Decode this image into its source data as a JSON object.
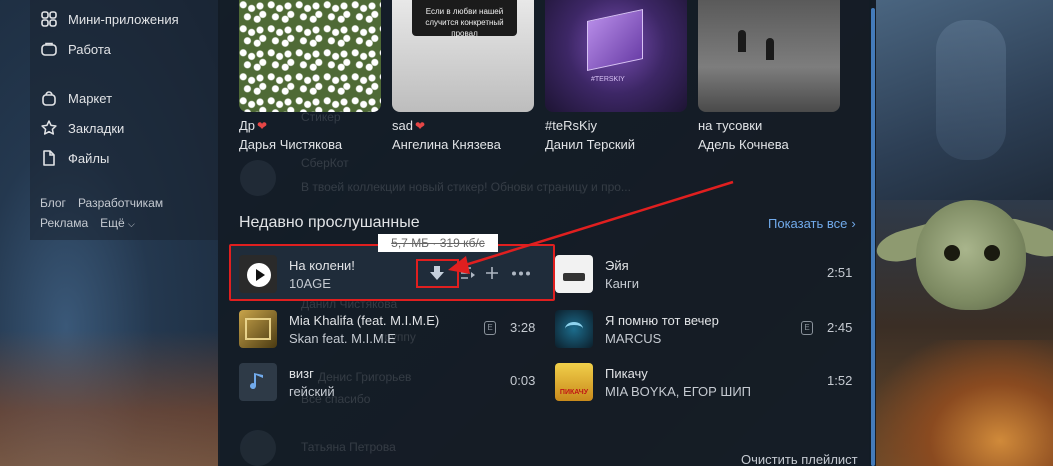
{
  "sidebar": {
    "items": [
      {
        "label": "Мини-приложения",
        "icon": "grid-icon"
      },
      {
        "label": "Работа",
        "icon": "briefcase-icon"
      },
      {
        "label": "Маркет",
        "icon": "bag-icon"
      },
      {
        "label": "Закладки",
        "icon": "star-icon"
      },
      {
        "label": "Файлы",
        "icon": "file-icon"
      }
    ],
    "footer_links": [
      "Блог",
      "Разработчикам",
      "Реклама",
      "Ещё"
    ]
  },
  "playlists": [
    {
      "title": "Др",
      "author": "Дарья Чистякова",
      "heart": true
    },
    {
      "title": "sad",
      "author": "Ангелина Князева",
      "heart": true,
      "cover_text": "Если в любви нашей случится конкретный провал"
    },
    {
      "title": "#teRsKiy",
      "author": "Данил Терский",
      "heart": false,
      "cover_text": "#TERSKIY"
    },
    {
      "title": "на тусовки",
      "author": "Адель Кочнева",
      "heart": false
    }
  ],
  "recent": {
    "title": "Недавно прослушанные",
    "show_all": "Показать все",
    "clear": "Очистить плейлист",
    "tooltip": "5,7 МБ · 319 кб/с",
    "tracks_left": [
      {
        "title": "На колени!",
        "artist": "10AGE",
        "duration": "",
        "explicit": false,
        "active": true
      },
      {
        "title": "Mia Khalifa (feat. M.I.M.E)",
        "artist": "Skan feat. M.I.M.E",
        "duration": "3:28",
        "explicit": true
      },
      {
        "title": "визг",
        "artist": "гейский",
        "duration": "0:03",
        "explicit": false
      }
    ],
    "tracks_right": [
      {
        "title": "Эйя",
        "artist": "Канги",
        "duration": "2:51",
        "explicit": false
      },
      {
        "title": "Я помню тот вечер",
        "artist": "MARCUS",
        "duration": "2:45",
        "explicit": true
      },
      {
        "title": "Пикачу",
        "artist": "MIA BOYKA, ЕГОР ШИП",
        "duration": "1:52",
        "explicit": false,
        "cover_text": "ПИКАЧУ"
      }
    ],
    "explicit_label": "E"
  },
  "ghost_feed": {
    "sticker": "Стикер",
    "user1": "СберКот",
    "msg1": "В твоей коллекции новый стикер! Обнови страницу и про...",
    "user2": "Данил Чистякова",
    "user3": "Денис Григорьев",
    "msg3": "Все спасибо",
    "user4": "Татьяна Петрова",
    "group": "группу"
  },
  "colors": {
    "accent": "#71aaeb",
    "highlight": "#e01f1f",
    "panel": "#131c26"
  }
}
